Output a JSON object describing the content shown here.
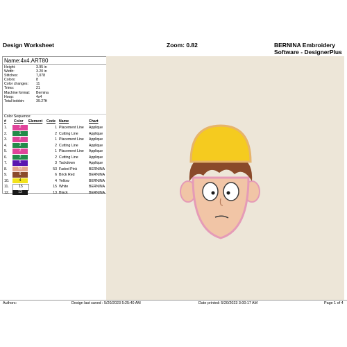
{
  "header": {
    "title": "Design Worksheet",
    "zoom_label": "Zoom:",
    "zoom_value": "0.82",
    "software_line1": "BERNINA Embroidery",
    "software_line2": "Software - DesignerPlus"
  },
  "design": {
    "name": "Name:4x4.ART80",
    "info": [
      {
        "label": "Height:",
        "value": "3.95 in"
      },
      {
        "label": "Width:",
        "value": "3.20 in"
      },
      {
        "label": "Stitches:",
        "value": "7,078"
      },
      {
        "label": "Colors:",
        "value": "8"
      },
      {
        "label": "Color changes:",
        "value": "11"
      },
      {
        "label": "Trims:",
        "value": "21"
      },
      {
        "label": "Machine format:",
        "value": "Bernina"
      },
      {
        "label": "Hoop:",
        "value": "4x4"
      },
      {
        "label": "Total bobbin:",
        "value": "39.27ft"
      }
    ]
  },
  "sequence": {
    "title": "Color Sequence:",
    "headers": {
      "index": "#",
      "color": "Color",
      "element": "Element",
      "code": "Code",
      "name": "Name",
      "chart": "Chart"
    },
    "rows": [
      {
        "index": "1.",
        "swatch": "2",
        "code": "1",
        "name": "Placement Line",
        "chart": "Applique",
        "color": "#e0449b"
      },
      {
        "index": "2.",
        "swatch": "1",
        "code": "2",
        "name": "Cutting Line",
        "chart": "Applique",
        "color": "#228b4a"
      },
      {
        "index": "3.",
        "swatch": "2",
        "code": "1",
        "name": "Placement Line",
        "chart": "Applique",
        "color": "#e0449b"
      },
      {
        "index": "4.",
        "swatch": "3",
        "code": "2",
        "name": "Cutting Line",
        "chart": "Applique",
        "color": "#228b4a"
      },
      {
        "index": "5.",
        "swatch": "2",
        "code": "1",
        "name": "Placement Line",
        "chart": "Applique",
        "color": "#e0449b"
      },
      {
        "index": "6.",
        "swatch": "3",
        "code": "2",
        "name": "Cutting Line",
        "chart": "Applique",
        "color": "#228b4a"
      },
      {
        "index": "7.",
        "swatch": "5",
        "code": "3",
        "name": "Tackdown",
        "chart": "Applique",
        "color": "#5a16b0"
      },
      {
        "index": "8.",
        "swatch": "53",
        "code": "53",
        "name": "Faded Pink",
        "chart": "BERNINA",
        "color": "#e3a58e"
      },
      {
        "index": "9.",
        "swatch": "6",
        "code": "6",
        "name": "Brick Red",
        "chart": "BERNINA",
        "color": "#8b4a2b"
      },
      {
        "index": "10.",
        "swatch": "4",
        "code": "4",
        "name": "Yellow",
        "chart": "BERNINA",
        "color": "#f2e21a"
      },
      {
        "index": "11.",
        "swatch": "15",
        "code": "15",
        "name": "White",
        "chart": "BERNINA",
        "color": "#ffffff"
      },
      {
        "index": "12.",
        "swatch": "13",
        "code": "13",
        "name": "Black",
        "chart": "BERNINA",
        "color": "#1a1a1a"
      }
    ]
  },
  "footer": {
    "authors": "Authors:",
    "last_saved": "Design last saved : 5/20/2023 5:25:40 AM",
    "printed": "Date printed: 5/20/2023 3:00:17 AM",
    "page": "Page 1 of 4"
  }
}
